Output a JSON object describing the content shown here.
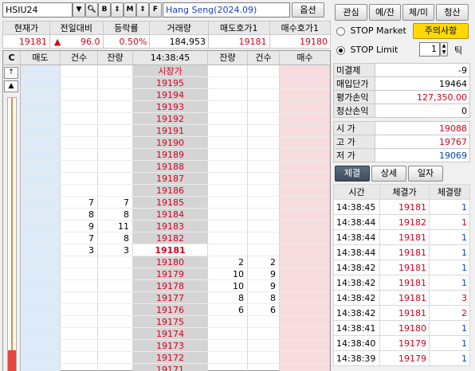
{
  "toolbar": {
    "symbol": "HSIU24",
    "contract_name": "Hang Seng(2024.09)",
    "options_label": "옵션",
    "icon_labels": [
      "B",
      "M",
      "F"
    ]
  },
  "summary": {
    "headers": [
      "현재가",
      "전일대비",
      "등락률",
      "거래량",
      "매도호가1",
      "매수호가1"
    ],
    "current": "19181",
    "change_arrow": "▲",
    "change": "96.0",
    "rate": "0.50%",
    "volume": "184,953",
    "ask1": "19181",
    "bid1": "19180"
  },
  "tabs": [
    "관심",
    "예/잔",
    "체/미",
    "청산"
  ],
  "stop": {
    "market_label": "STOP Market",
    "limit_label": "STOP Limit",
    "tick_value": "1",
    "tick_label": "틱",
    "warning_label": "주의사항"
  },
  "orderbook": {
    "headers": [
      "매도",
      "건수",
      "잔량",
      "14:38:45",
      "잔량",
      "건수",
      "매수"
    ],
    "side_c": "C",
    "market_price_label": "시장가",
    "rows": [
      {
        "s_cnt": "",
        "s_qty": "",
        "price": "19195",
        "b_qty": "",
        "b_cnt": ""
      },
      {
        "s_cnt": "",
        "s_qty": "",
        "price": "19194",
        "b_qty": "",
        "b_cnt": ""
      },
      {
        "s_cnt": "",
        "s_qty": "",
        "price": "19193",
        "b_qty": "",
        "b_cnt": ""
      },
      {
        "s_cnt": "",
        "s_qty": "",
        "price": "19192",
        "b_qty": "",
        "b_cnt": ""
      },
      {
        "s_cnt": "",
        "s_qty": "",
        "price": "19191",
        "b_qty": "",
        "b_cnt": ""
      },
      {
        "s_cnt": "",
        "s_qty": "",
        "price": "19190",
        "b_qty": "",
        "b_cnt": ""
      },
      {
        "s_cnt": "",
        "s_qty": "",
        "price": "19189",
        "b_qty": "",
        "b_cnt": ""
      },
      {
        "s_cnt": "",
        "s_qty": "",
        "price": "19188",
        "b_qty": "",
        "b_cnt": ""
      },
      {
        "s_cnt": "",
        "s_qty": "",
        "price": "19187",
        "b_qty": "",
        "b_cnt": ""
      },
      {
        "s_cnt": "",
        "s_qty": "",
        "price": "19186",
        "b_qty": "",
        "b_cnt": ""
      },
      {
        "s_cnt": "7",
        "s_qty": "7",
        "price": "19185",
        "b_qty": "",
        "b_cnt": ""
      },
      {
        "s_cnt": "8",
        "s_qty": "8",
        "price": "19184",
        "b_qty": "",
        "b_cnt": ""
      },
      {
        "s_cnt": "9",
        "s_qty": "11",
        "price": "19183",
        "b_qty": "",
        "b_cnt": ""
      },
      {
        "s_cnt": "7",
        "s_qty": "8",
        "price": "19182",
        "b_qty": "",
        "b_cnt": ""
      },
      {
        "s_cnt": "3",
        "s_qty": "3",
        "price": "19181",
        "b_qty": "",
        "b_cnt": "",
        "current": true
      },
      {
        "s_cnt": "",
        "s_qty": "",
        "price": "19180",
        "b_qty": "2",
        "b_cnt": "2"
      },
      {
        "s_cnt": "",
        "s_qty": "",
        "price": "19179",
        "b_qty": "10",
        "b_cnt": "9"
      },
      {
        "s_cnt": "",
        "s_qty": "",
        "price": "19178",
        "b_qty": "10",
        "b_cnt": "9"
      },
      {
        "s_cnt": "",
        "s_qty": "",
        "price": "19177",
        "b_qty": "8",
        "b_cnt": "8"
      },
      {
        "s_cnt": "",
        "s_qty": "",
        "price": "19176",
        "b_qty": "6",
        "b_cnt": "6"
      },
      {
        "s_cnt": "",
        "s_qty": "",
        "price": "19175",
        "b_qty": "",
        "b_cnt": ""
      },
      {
        "s_cnt": "",
        "s_qty": "",
        "price": "19174",
        "b_qty": "",
        "b_cnt": ""
      },
      {
        "s_cnt": "",
        "s_qty": "",
        "price": "19173",
        "b_qty": "",
        "b_cnt": ""
      },
      {
        "s_cnt": "",
        "s_qty": "",
        "price": "19172",
        "b_qty": "",
        "b_cnt": ""
      },
      {
        "s_cnt": "",
        "s_qty": "",
        "price": "19171",
        "b_qty": "",
        "b_cnt": ""
      }
    ]
  },
  "position": {
    "unsettled_label": "미결제",
    "unsettled": "-9",
    "avg_price_label": "매입단가",
    "avg_price": "19464",
    "pnl_label": "평가손익",
    "pnl": "127,350.00",
    "realized_label": "청산손익",
    "realized": "0",
    "open_label": "시 가",
    "open": "19088",
    "high_label": "고 가",
    "high": "19767",
    "low_label": "저 가",
    "low": "19069"
  },
  "trade_tabs": [
    "체결",
    "상세",
    "일자"
  ],
  "trades": {
    "headers": [
      "시간",
      "체결가",
      "체결량"
    ],
    "rows": [
      {
        "time": "14:38:45",
        "price": "19181",
        "qty": "1",
        "qty_color": "#0044cc"
      },
      {
        "time": "14:38:44",
        "price": "19182",
        "qty": "1",
        "qty_color": "#d6001c"
      },
      {
        "time": "14:38:44",
        "price": "19181",
        "qty": "1",
        "qty_color": "#0044cc"
      },
      {
        "time": "14:38:44",
        "price": "19181",
        "qty": "1",
        "qty_color": "#0044cc"
      },
      {
        "time": "14:38:42",
        "price": "19181",
        "qty": "1",
        "qty_color": "#0044cc"
      },
      {
        "time": "14:38:42",
        "price": "19181",
        "qty": "1",
        "qty_color": "#0044cc"
      },
      {
        "time": "14:38:42",
        "price": "19181",
        "qty": "3",
        "qty_color": "#d6001c"
      },
      {
        "time": "14:38:42",
        "price": "19181",
        "qty": "2",
        "qty_color": "#d6001c"
      },
      {
        "time": "14:38:41",
        "price": "19180",
        "qty": "1",
        "qty_color": "#0044cc"
      },
      {
        "time": "14:38:40",
        "price": "19179",
        "qty": "1",
        "qty_color": "#0044cc"
      },
      {
        "time": "14:38:39",
        "price": "19179",
        "qty": "1",
        "qty_color": "#0044cc"
      }
    ]
  }
}
